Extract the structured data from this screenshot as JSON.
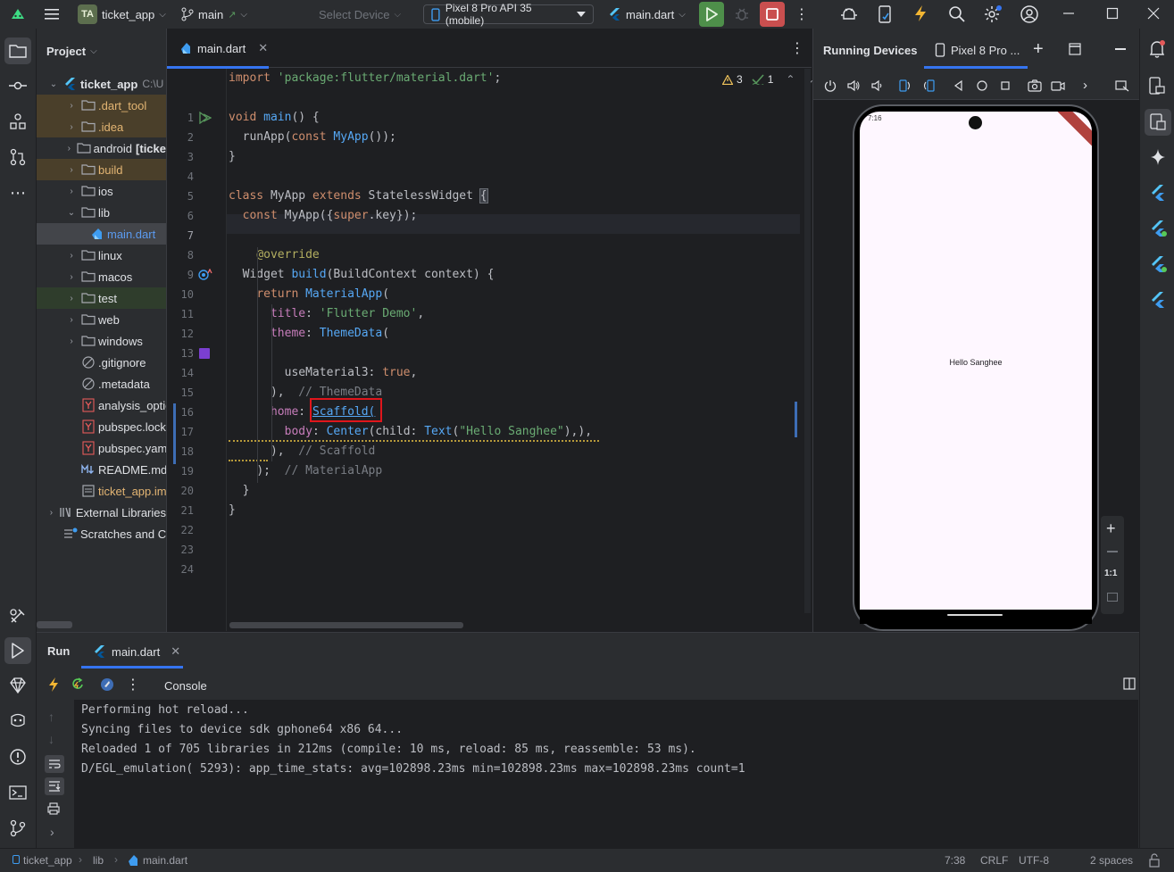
{
  "titlebar": {
    "project_badge": "TA",
    "project_name": "ticket_app",
    "branch": "main",
    "select_device": "Select Device",
    "device": "Pixel 8 Pro API 35 (mobile)",
    "run_config": "main.dart"
  },
  "project_panel": {
    "title": "Project",
    "root": {
      "name": "ticket_app",
      "path": "C:\\U"
    },
    "items": [
      {
        "label": ".dart_tool",
        "type": "folder"
      },
      {
        "label": ".idea",
        "type": "folder"
      },
      {
        "label": "android",
        "suffix": "[ticke",
        "type": "folder"
      },
      {
        "label": "build",
        "type": "folder"
      },
      {
        "label": "ios",
        "type": "folder"
      },
      {
        "label": "lib",
        "type": "folder"
      },
      {
        "label": "main.dart",
        "type": "dart"
      },
      {
        "label": "linux",
        "type": "folder"
      },
      {
        "label": "macos",
        "type": "folder"
      },
      {
        "label": "test",
        "type": "folder"
      },
      {
        "label": "web",
        "type": "folder"
      },
      {
        "label": "windows",
        "type": "folder"
      },
      {
        "label": ".gitignore",
        "type": "file"
      },
      {
        "label": ".metadata",
        "type": "file"
      },
      {
        "label": "analysis_optio",
        "type": "yaml"
      },
      {
        "label": "pubspec.lock",
        "type": "yaml"
      },
      {
        "label": "pubspec.yaml",
        "type": "yaml"
      },
      {
        "label": "README.md",
        "type": "md"
      },
      {
        "label": "ticket_app.iml",
        "type": "iml"
      },
      {
        "label": "External Libraries",
        "type": "lib"
      },
      {
        "label": "Scratches and Co",
        "type": "scratch"
      }
    ]
  },
  "editor": {
    "tab": "main.dart",
    "warnings": "3",
    "checks": "1",
    "line_numbers": [
      "1",
      "2",
      "3",
      "4",
      "5",
      "6",
      "7",
      "8",
      "9",
      "10",
      "11",
      "12",
      "13",
      "14",
      "15",
      "16",
      "17",
      "18",
      "19",
      "20",
      "21",
      "22",
      "23",
      "24"
    ],
    "current_line": "7",
    "code": {
      "l1_kw": "import",
      "l1_str": "'package:flutter/material.dart'",
      "l1_end": ";",
      "l3_kw": "void",
      "l3_fn": "main",
      "l3_end": "() {",
      "l4_a": "  runApp(",
      "l4_kw": "const",
      "l4_cls": "MyApp",
      "l4_end": "());",
      "l5": "}",
      "l7_kw1": "class",
      "l7_a": " MyApp ",
      "l7_kw2": "extends",
      "l7_b": " StatelessWidget ",
      "l7_c": "{",
      "l8_kw": "const",
      "l8_a": " MyApp({",
      "l8_kw2": "super",
      "l8_b": ".key});",
      "l10": "@override",
      "l11_a": "  Widget ",
      "l11_fn": "build",
      "l11_b": "(BuildContext context) {",
      "l12_kw": "return",
      "l12_cls": "MaterialApp",
      "l12_end": "(",
      "l13_p": "title",
      "l13_a": ": ",
      "l13_str": "'Flutter Demo'",
      "l13_end": ",",
      "l14_p": "theme",
      "l14_a": ": ",
      "l14_cls": "ThemeData",
      "l14_end": "(",
      "l16_a": "useMaterial3: ",
      "l16_kw": "true",
      "l16_end": ",",
      "l17_a": "),  ",
      "l17_cmt": "// ThemeData",
      "l18_p": "home",
      "l18_a": ": ",
      "l18_cls": "Scaffold(",
      "l19_p": "body",
      "l19_a": ": ",
      "l19_cls": "Center",
      "l19_b": "(child: ",
      "l19_cls2": "Text",
      "l19_c": "(",
      "l19_str": "\"Hello Sanghee\"",
      "l19_end": "),),",
      "l20_a": "),  ",
      "l20_cmt": "// Scaffold",
      "l21_a": ");  ",
      "l21_cmt": "// MaterialApp",
      "l22": "}",
      "l23": "}"
    }
  },
  "devices": {
    "title": "Running Devices",
    "tab": "Pixel 8 Pro ...",
    "phone_text": "Hello Sanghee",
    "status_time": "7:16",
    "zoom_label": "1:1"
  },
  "run_panel": {
    "title": "Run",
    "tab": "main.dart",
    "console_label": "Console",
    "lines": [
      "Performing hot reload...",
      "Syncing files to device sdk gphone64 x86 64...",
      "Reloaded 1 of 705 libraries in 212ms (compile: 10 ms, reload: 85 ms, reassemble: 53 ms).",
      "D/EGL_emulation( 5293): app_time_stats: avg=102898.23ms min=102898.23ms max=102898.23ms count=1"
    ]
  },
  "statusbar": {
    "crumbs": [
      "ticket_app",
      "lib",
      "main.dart"
    ],
    "position": "7:38",
    "line_sep": "CRLF",
    "encoding": "UTF-8",
    "indent": "2 spaces"
  },
  "colors": {
    "accent": "#3574f0",
    "highlight_box": "#e0161c",
    "run_green": "#4e8f4a",
    "stop_red": "#c94f4f"
  }
}
